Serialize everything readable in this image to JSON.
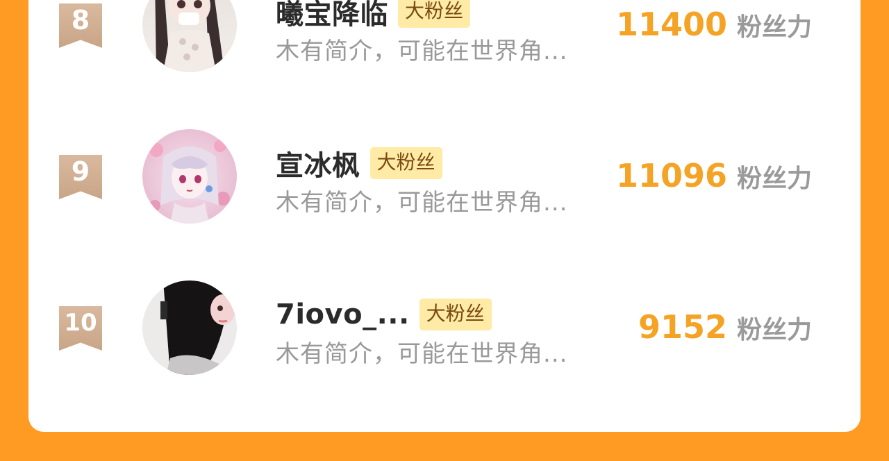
{
  "colors": {
    "background": "#FF9A22",
    "card": "#FFFFFF",
    "score": "#F5A324",
    "badge_bg": "#FFEBA6",
    "rank_ribbon": "#D4B496"
  },
  "ranking": [
    {
      "rank": "8",
      "name": "曦宝降临",
      "badge": "大粉丝",
      "bio": "木有简介，可能在世界角...",
      "score": "11400",
      "unit": "粉丝力"
    },
    {
      "rank": "9",
      "name": "宣冰枫",
      "badge": "大粉丝",
      "bio": "木有简介，可能在世界角...",
      "score": "11096",
      "unit": "粉丝力"
    },
    {
      "rank": "10",
      "name": "7iovo_...",
      "badge": "大粉丝",
      "bio": "木有简介，可能在世界角...",
      "score": "9152",
      "unit": "粉丝力"
    }
  ]
}
